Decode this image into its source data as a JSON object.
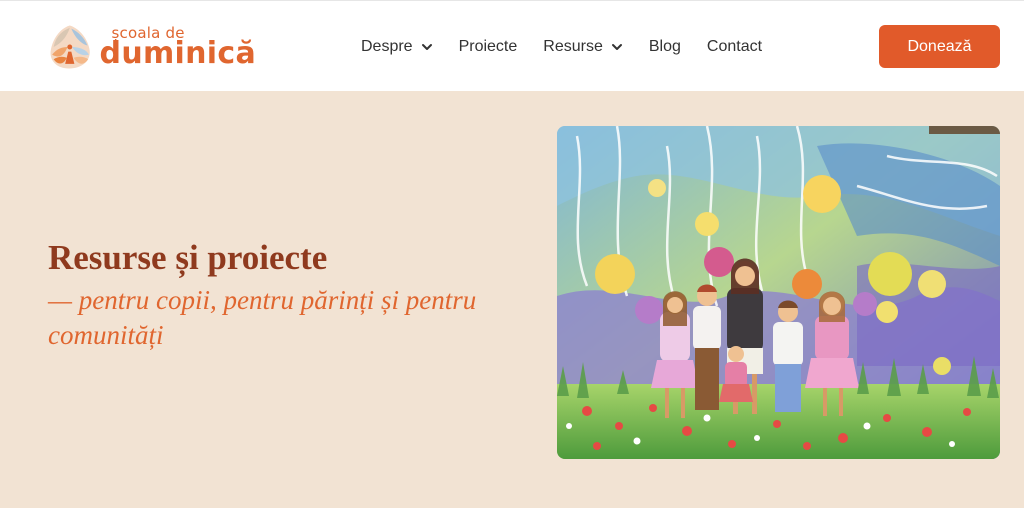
{
  "header": {
    "logo": {
      "line1": "școala de",
      "line2": "duminică",
      "icon": "school-logo-icon"
    },
    "nav": [
      {
        "label": "Despre",
        "has_dropdown": true
      },
      {
        "label": "Proiecte",
        "has_dropdown": false
      },
      {
        "label": "Resurse",
        "has_dropdown": true
      },
      {
        "label": "Blog",
        "has_dropdown": false
      },
      {
        "label": "Contact",
        "has_dropdown": false
      }
    ],
    "donate_label": "Donează"
  },
  "hero": {
    "title": "Resurse și proiecte",
    "subtitle": "— pentru copii, pentru părinți și pentru comunități",
    "image_icon": "children-watercolor-painting"
  },
  "colors": {
    "accent": "#e15a2a",
    "logo_orange": "#e0662f",
    "title_brown": "#8f3a1e",
    "page_background": "#f2e3d3",
    "header_background": "#ffffff"
  }
}
